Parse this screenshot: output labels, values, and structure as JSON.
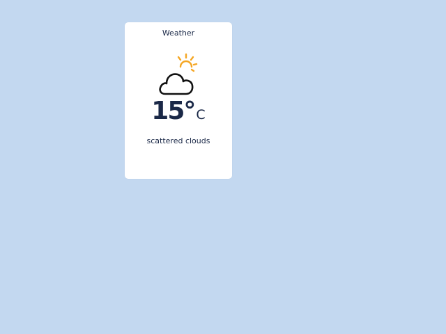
{
  "weather": {
    "title": "Weather",
    "icon": "partly-cloudy-icon",
    "temperature": "15°",
    "unit": "C",
    "description": "scattered clouds"
  },
  "colors": {
    "background": "#c3d8f0",
    "card": "#ffffff",
    "text": "#1a2847",
    "sun": "#f5a623"
  }
}
